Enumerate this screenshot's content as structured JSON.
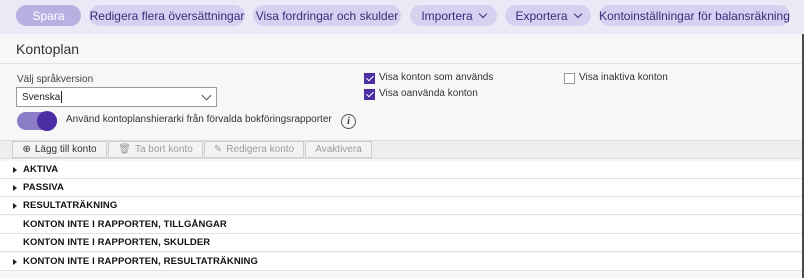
{
  "toolbar": {
    "save_label": "Spara",
    "edit_translations_label": "Redigera flera översättningar",
    "receivables_label": "Visa fordringar och skulder",
    "import_label": "Importera",
    "export_label": "Exportera",
    "settings_label": "Kontoinställningar för balansräkning"
  },
  "page": {
    "title": "Kontoplan"
  },
  "language": {
    "label": "Välj språkversion",
    "value": "Svenska"
  },
  "options": {
    "show_used": {
      "label": "Visa konton som används",
      "checked": true
    },
    "show_unused": {
      "label": "Visa oanvända konton",
      "checked": true
    },
    "show_inactive": {
      "label": "Visa inaktiva konton",
      "checked": false
    }
  },
  "hierarchy_toggle": {
    "label": "Använd kontoplanshierarki från förvalda bokföringsrapporter",
    "on": true
  },
  "actions": {
    "add_label": "Lägg till konto",
    "delete_label": "Ta bort konto",
    "edit_label": "Redigera konto",
    "deactivate_label": "Avaktivera"
  },
  "tree": [
    {
      "label": "AKTIVA",
      "expandable": true
    },
    {
      "label": "PASSIVA",
      "expandable": true
    },
    {
      "label": "RESULTATRÄKNING",
      "expandable": true
    },
    {
      "label": "KONTON INTE I RAPPORTEN, TILLGÅNGAR",
      "expandable": false
    },
    {
      "label": "KONTON INTE I RAPPORTEN, SKULDER",
      "expandable": false
    },
    {
      "label": "KONTON INTE I RAPPORTEN, RESULTATRÄKNING",
      "expandable": true
    }
  ],
  "colors": {
    "accent": "#4b2fa3",
    "toolbar_bg": "#ece9f7",
    "pill_bg": "#d7d1f1"
  }
}
